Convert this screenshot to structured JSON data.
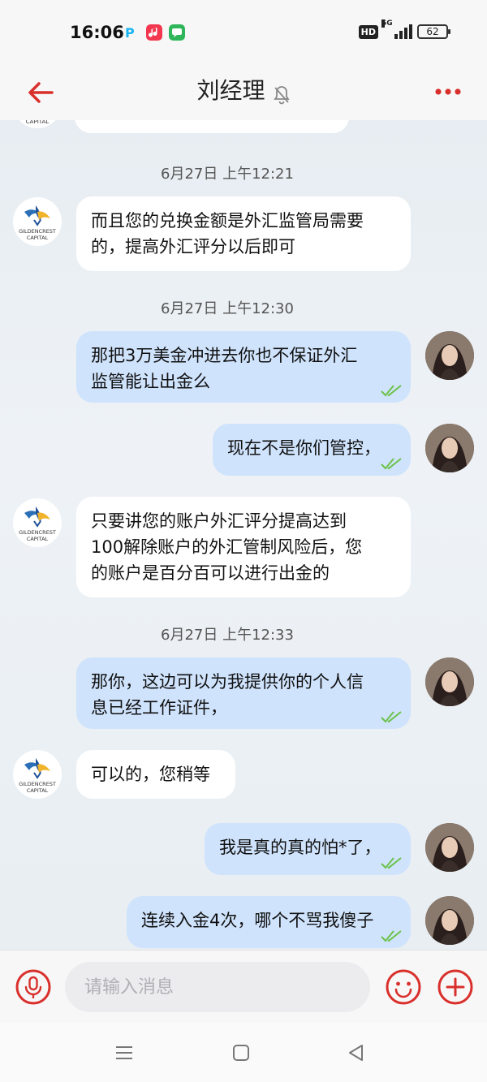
{
  "status_bar": {
    "time": "16:06",
    "hd": "HD",
    "net": "5G",
    "battery": "62"
  },
  "header": {
    "title": "刘经理"
  },
  "chat": {
    "timestamps": [
      "6月27日 上午12:21",
      "6月27日 上午12:30",
      "6月27日 上午12:33"
    ],
    "avatar_logo_text": [
      "GILDENCREST",
      "CAPITAL"
    ],
    "messages": [
      {
        "side": "left",
        "text": [
          "而且您的兑换金额是外汇监管局需要",
          "的，提高外汇评分以后即可"
        ]
      },
      {
        "side": "right",
        "text": [
          "那把3万美金冲进去你也不保证外汇",
          "监管能让出金么"
        ]
      },
      {
        "side": "right",
        "text": [
          "现在不是你们管控，"
        ]
      },
      {
        "side": "left",
        "text": [
          "只要讲您的账户外汇评分提高达到",
          "100解除账户的外汇管制风险后，您",
          "的账户是百分百可以进行出金的"
        ]
      },
      {
        "side": "right",
        "text": [
          "那你，这边可以为我提供你的个人信",
          "息已经工作证件，"
        ]
      },
      {
        "side": "left",
        "text": [
          "可以的，您稍等"
        ]
      },
      {
        "side": "right",
        "text": [
          "我是真的真的怕*了，"
        ]
      },
      {
        "side": "right",
        "text": [
          "连续入金4次，哪个不骂我傻子"
        ]
      }
    ]
  },
  "input": {
    "placeholder": "请输入消息"
  },
  "colors": {
    "accent": "#d9302c",
    "bubble_right": "#cfe3fc",
    "bubble_left": "#ffffff",
    "check": "#6cc24a"
  }
}
